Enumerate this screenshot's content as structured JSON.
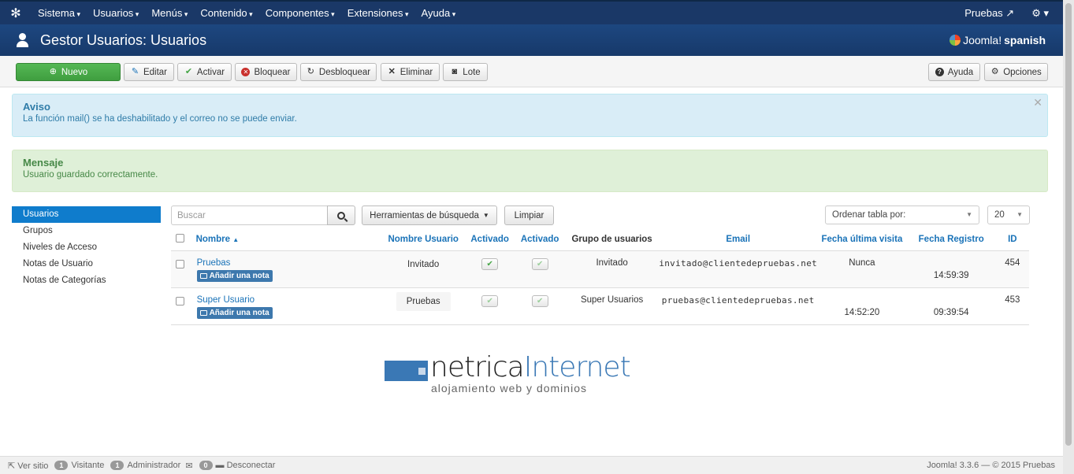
{
  "topbar": {
    "menu": [
      "Sistema",
      "Usuarios",
      "Menús",
      "Contenido",
      "Componentes",
      "Extensiones",
      "Ayuda"
    ],
    "site_link": "Pruebas"
  },
  "header": {
    "title": "Gestor Usuarios: Usuarios",
    "brand_a": "Joomla!",
    "brand_b": "spanish"
  },
  "toolbar": {
    "new": "Nuevo",
    "edit": "Editar",
    "activate": "Activar",
    "block": "Bloquear",
    "unblock": "Desbloquear",
    "delete": "Eliminar",
    "batch": "Lote",
    "help": "Ayuda",
    "options": "Opciones"
  },
  "alerts": {
    "warning_title": "Aviso",
    "warning_text": "La función mail() se ha deshabilitado y el correo no se puede enviar.",
    "message_title": "Mensaje",
    "message_text": "Usuario guardado correctamente."
  },
  "sidebar": {
    "items": [
      "Usuarios",
      "Grupos",
      "Niveles de Acceso",
      "Notas de Usuario",
      "Notas de Categorías"
    ]
  },
  "filters": {
    "search_placeholder": "Buscar",
    "search_tools": "Herramientas de búsqueda",
    "clear": "Limpiar",
    "order_by": "Ordenar tabla por:",
    "limit": "20"
  },
  "table": {
    "headers": [
      "Nombre",
      "Nombre Usuario",
      "Activado",
      "Activado",
      "Grupo de usuarios",
      "Email",
      "Fecha última visita",
      "Fecha Registro",
      "ID"
    ],
    "add_note": "Añadir una nota",
    "rows": [
      {
        "name": "Pruebas",
        "username": "Invitado",
        "group": "Invitado",
        "email": "invitado@clientedepruebas.net",
        "last_visit": "Nunca",
        "registered": "14:59:39",
        "id": "454"
      },
      {
        "name": "Super Usuario",
        "username": "Pruebas",
        "group": "Super Usuarios",
        "email": "pruebas@clientedepruebas.net",
        "last_visit": "14:52:20",
        "registered": "09:39:54",
        "id": "453"
      }
    ]
  },
  "footer_logo": {
    "part1": "netrica",
    "part2": "Internet",
    "tagline": "alojamiento web y dominios"
  },
  "status": {
    "view_site": "Ver sitio",
    "visitors_count": "1",
    "visitors_label": "Visitante",
    "admins_count": "1",
    "admins_label": "Administrador",
    "messages_count": "0",
    "logout": "Desconectar",
    "version": "Joomla! 3.3.6 — © 2015 Pruebas"
  }
}
